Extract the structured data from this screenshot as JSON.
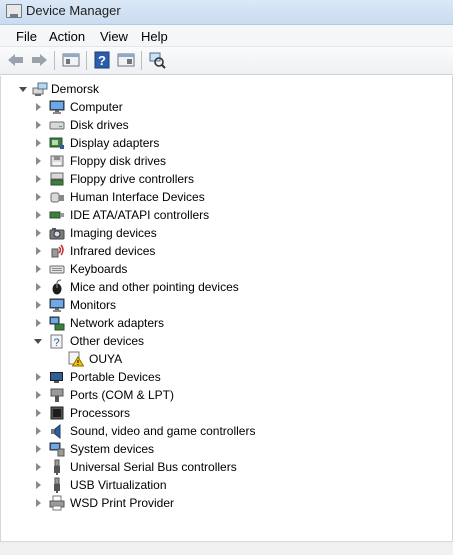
{
  "window": {
    "title": "Device Manager",
    "title_icon": "device-manager-icon"
  },
  "menu": {
    "items": [
      "File",
      "Action",
      "View",
      "Help"
    ]
  },
  "toolbar": {
    "buttons": [
      "back-arrow-icon",
      "forward-arrow-icon",
      "properties-icon",
      "help-icon",
      "show-hide-icon",
      "scan-hardware-icon"
    ]
  },
  "tree": {
    "root": {
      "label": "Demorsk",
      "icon": "computer-network-icon",
      "expanded": true
    },
    "categories": [
      {
        "label": "Computer",
        "icon": "monitor-icon",
        "expanded": false
      },
      {
        "label": "Disk drives",
        "icon": "disk-drive-icon",
        "expanded": false
      },
      {
        "label": "Display adapters",
        "icon": "display-adapter-icon",
        "expanded": false
      },
      {
        "label": "Floppy disk drives",
        "icon": "floppy-disk-icon",
        "expanded": false
      },
      {
        "label": "Floppy drive controllers",
        "icon": "floppy-controller-icon",
        "expanded": false
      },
      {
        "label": "Human Interface Devices",
        "icon": "hid-icon",
        "expanded": false
      },
      {
        "label": "IDE ATA/ATAPI controllers",
        "icon": "ide-controller-icon",
        "expanded": false
      },
      {
        "label": "Imaging devices",
        "icon": "camera-icon",
        "expanded": false
      },
      {
        "label": "Infrared devices",
        "icon": "infrared-icon",
        "expanded": false
      },
      {
        "label": "Keyboards",
        "icon": "keyboard-icon",
        "expanded": false
      },
      {
        "label": "Mice and other pointing devices",
        "icon": "mouse-icon",
        "expanded": false
      },
      {
        "label": "Monitors",
        "icon": "monitor-icon",
        "expanded": false
      },
      {
        "label": "Network adapters",
        "icon": "network-adapter-icon",
        "expanded": false
      },
      {
        "label": "Other devices",
        "icon": "unknown-device-icon",
        "expanded": true,
        "children": [
          {
            "label": "OUYA",
            "icon": "warning-device-icon"
          }
        ]
      },
      {
        "label": "Portable Devices",
        "icon": "portable-device-icon",
        "expanded": false
      },
      {
        "label": "Ports (COM & LPT)",
        "icon": "port-icon",
        "expanded": false
      },
      {
        "label": "Processors",
        "icon": "processor-icon",
        "expanded": false
      },
      {
        "label": "Sound, video and game controllers",
        "icon": "speaker-icon",
        "expanded": false
      },
      {
        "label": "System devices",
        "icon": "system-device-icon",
        "expanded": false
      },
      {
        "label": "Universal Serial Bus controllers",
        "icon": "usb-icon",
        "expanded": false
      },
      {
        "label": "USB Virtualization",
        "icon": "usb-icon",
        "expanded": false
      },
      {
        "label": "WSD Print Provider",
        "icon": "printer-icon",
        "expanded": false
      }
    ]
  },
  "colors": {
    "warning": "#f4c400",
    "titlebar": "#c9dcf1",
    "help_blue": "#2a5db0"
  }
}
